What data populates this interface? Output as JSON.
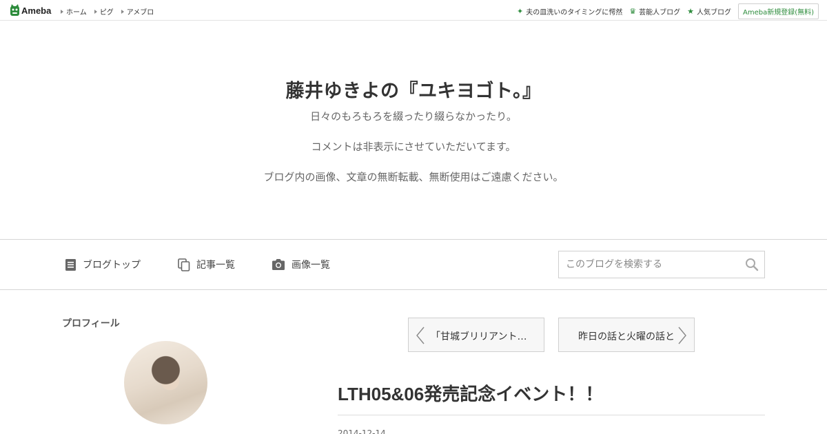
{
  "topbar": {
    "logo_text": "Ameba",
    "nav": [
      "ホーム",
      "ピグ",
      "アメブロ"
    ],
    "right_items": [
      {
        "label": "夫の皿洗いのタイミングに愕然",
        "icon": "sparkle-icon"
      },
      {
        "label": "芸能人ブログ",
        "icon": "crown-icon"
      },
      {
        "label": "人気ブログ",
        "icon": "star-icon"
      }
    ],
    "signup_label": "Ameba新規登録(無料)",
    "accent_color": "#2d8c3c"
  },
  "header": {
    "title": "藤井ゆきよの『ユキヨゴト。』",
    "description": [
      "日々のもろもろを綴ったり綴らなかったり。",
      "コメントは非表示にさせていただいてます。",
      "ブログ内の画像、文章の無断転載、無断使用はご遠慮ください。"
    ]
  },
  "nav": {
    "items": [
      {
        "label": "ブログトップ",
        "icon": "document-icon"
      },
      {
        "label": "記事一覧",
        "icon": "copy-icon"
      },
      {
        "label": "画像一覧",
        "icon": "camera-icon"
      }
    ],
    "search_placeholder": "このブログを検索する"
  },
  "sidebar": {
    "profile_heading": "プロフィール"
  },
  "pager": {
    "prev_label": "「甘城ブリリアント…",
    "next_label": "昨日の話と火曜の話と"
  },
  "article": {
    "title": "LTH05&06発売記念イベント！！",
    "date": "2014-12-14"
  }
}
